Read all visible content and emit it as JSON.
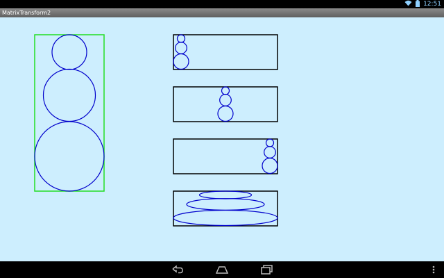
{
  "status": {
    "time": "12:51",
    "icons": [
      "wifi-icon",
      "battery-icon"
    ]
  },
  "app": {
    "title": "MatrixTransform2"
  },
  "canvas": {
    "frame_colors": {
      "main": "#22dd22",
      "thumbnails": "#000000",
      "circles": "#0000cc",
      "background": "#cdeefe"
    }
  },
  "navigation": {
    "buttons": [
      "back-icon",
      "home-icon",
      "recent-apps-icon",
      "overflow-menu-icon"
    ]
  }
}
